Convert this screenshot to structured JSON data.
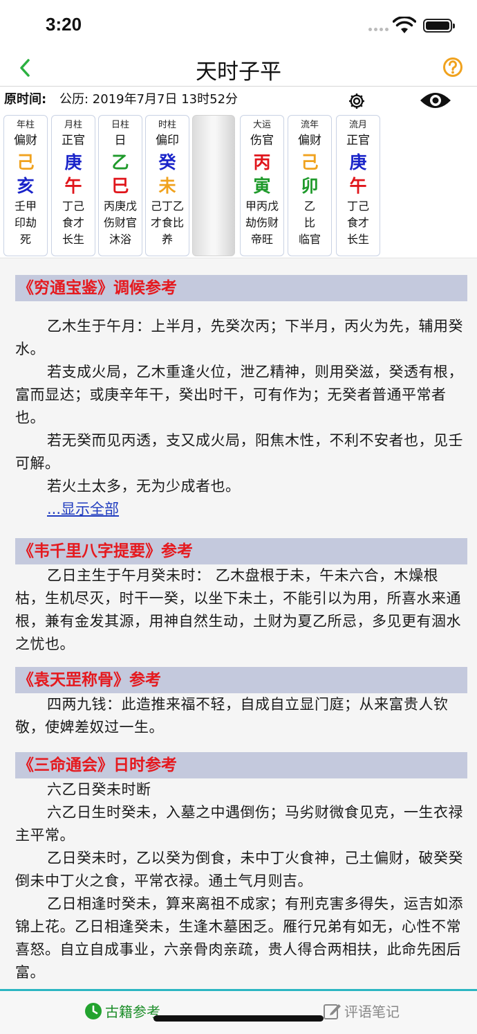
{
  "status_bar": {
    "time": "3:20"
  },
  "nav": {
    "title": "天时子平"
  },
  "origin": {
    "label": "原时间:",
    "value": "公历: 2019年7月7日 13时52分"
  },
  "pillars": [
    {
      "title": "年柱",
      "shishen": "偏财",
      "gan": "己",
      "gan_color": "#f0a21e",
      "zhi": "亥",
      "zhi_color": "#1a24c9",
      "canggan": "壬甲",
      "canggan_shishen": "印劫",
      "state": "死"
    },
    {
      "title": "月柱",
      "shishen": "正官",
      "gan": "庚",
      "gan_color": "#1a24c9",
      "zhi": "午",
      "zhi_color": "#e0151b",
      "canggan": "丁己",
      "canggan_shishen": "食才",
      "state": "长生"
    },
    {
      "title": "日柱",
      "shishen": "日",
      "gan": "乙",
      "gan_color": "#1f9a2b",
      "zhi": "巳",
      "zhi_color": "#e0151b",
      "canggan": "丙庚戊",
      "canggan_shishen": "伤财官",
      "state": "沐浴"
    },
    {
      "title": "时柱",
      "shishen": "偏印",
      "gan": "癸",
      "gan_color": "#1a24c9",
      "zhi": "未",
      "zhi_color": "#f0a21e",
      "canggan": "己丁乙",
      "canggan_shishen": "才食比",
      "state": "养"
    },
    {
      "title": "大运",
      "shishen": "伤官",
      "gan": "丙",
      "gan_color": "#e0151b",
      "zhi": "寅",
      "zhi_color": "#1f9a2b",
      "canggan": "甲丙戊",
      "canggan_shishen": "劫伤财",
      "state": "帝旺"
    },
    {
      "title": "流年",
      "shishen": "偏财",
      "gan": "己",
      "gan_color": "#f0a21e",
      "zhi": "卯",
      "zhi_color": "#1f9a2b",
      "canggan": "乙",
      "canggan_shishen": "比",
      "state": "临官"
    },
    {
      "title": "流月",
      "shishen": "正官",
      "gan": "庚",
      "gan_color": "#1a24c9",
      "zhi": "午",
      "zhi_color": "#e0151b",
      "canggan": "丁己",
      "canggan_shishen": "食才",
      "state": "长生"
    }
  ],
  "sections": {
    "qiongtong": {
      "header": "《穷通宝鉴》调候参考",
      "paragraphs": [
        "乙木生于午月：上半月，先癸次丙；下半月，丙火为先，辅用癸水。",
        "若支成火局，乙木重逢火位，泄乙精神，则用癸滋，癸透有根，富而显达；或庚辛年干，癸出时干，可有作为；无癸者普通平常者也。",
        "若无癸而见丙透，支又成火局，阳焦木性，不利不安者也，见壬可解。",
        "若火土太多，无为少成者也。"
      ],
      "show_all": "...显示全部"
    },
    "weiqianli": {
      "header": "《韦千里八字提要》参考",
      "paragraphs": [
        "乙日主生于午月癸未时： 乙木盘根于未，午未六合，木燥根枯，生机尽灭，时干一癸，以坐下未土，不能引以为用，所喜水来通根，兼有金发其源，用神自然生动，土财为夏乙所忌，多见更有涸水之忧也。"
      ]
    },
    "yuantiangang": {
      "header": "《袁天罡称骨》参考",
      "paragraphs": [
        "四两九钱：此造推来福不轻，自成自立显门庭；从来富贵人钦敬，使婢差奴过一生。"
      ]
    },
    "sanming": {
      "header": "《三命通会》日时参考",
      "paragraphs": [
        "六乙日癸未时断",
        "六乙日生时癸未，入墓之中遇倒伤；马劣财微食见克，一生衣禄主平常。",
        "乙日癸未时，乙以癸为倒食，未中丁火食神，己土偏财，破癸癸倒未中丁火之食，平常衣禄。通土气月则吉。",
        "乙日相逢时癸未，算来离祖不成家；有刑克害多得失，运吉如添锦上花。乙日相逢癸未，生逢木墓困乏。雁行兄弟有如无，心性不常喜怒。自立自成事业，六亲骨肉亲疏，贵人得合两相扶，此命先困后富。"
      ]
    }
  },
  "tabs": {
    "ancient": "古籍参考",
    "notes": "评语笔记"
  },
  "colors": {
    "accent_green": "#2bb140",
    "help_orange": "#f0a21e",
    "section_header_bg": "#c4c9dd",
    "section_header_text": "#e5191e"
  }
}
